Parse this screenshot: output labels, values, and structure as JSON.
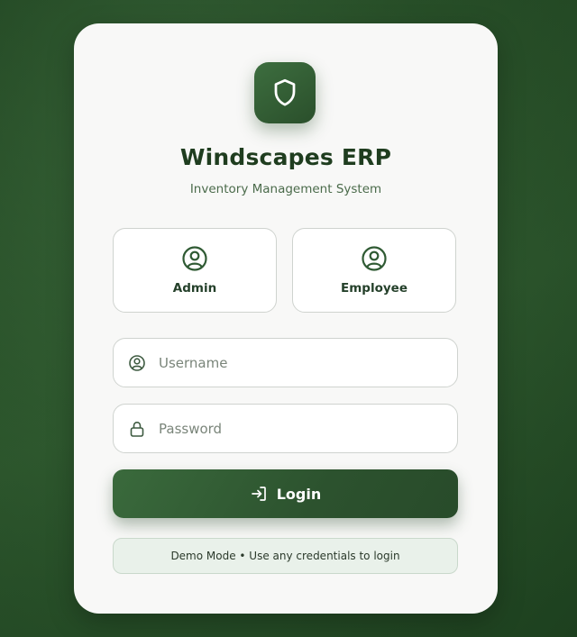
{
  "app": {
    "title": "Windscapes ERP",
    "subtitle": "Inventory Management System",
    "logo_icon": "shield-icon"
  },
  "roles": [
    {
      "label": "Admin",
      "icon": "user-circle-icon"
    },
    {
      "label": "Employee",
      "icon": "user-circle-icon"
    }
  ],
  "form": {
    "username": {
      "placeholder": "Username",
      "value": "",
      "icon": "user-circle-icon"
    },
    "password": {
      "placeholder": "Password",
      "value": "",
      "icon": "lock-icon"
    }
  },
  "login_button": {
    "label": "Login",
    "icon": "login-arrow-icon"
  },
  "demo_note": "Demo Mode • Use any credentials to login",
  "colors": {
    "primary": "#2c552c",
    "primary_dark": "#1f3d1f",
    "card_bg": "#f8f8f7",
    "note_bg": "#e9f1ea"
  }
}
